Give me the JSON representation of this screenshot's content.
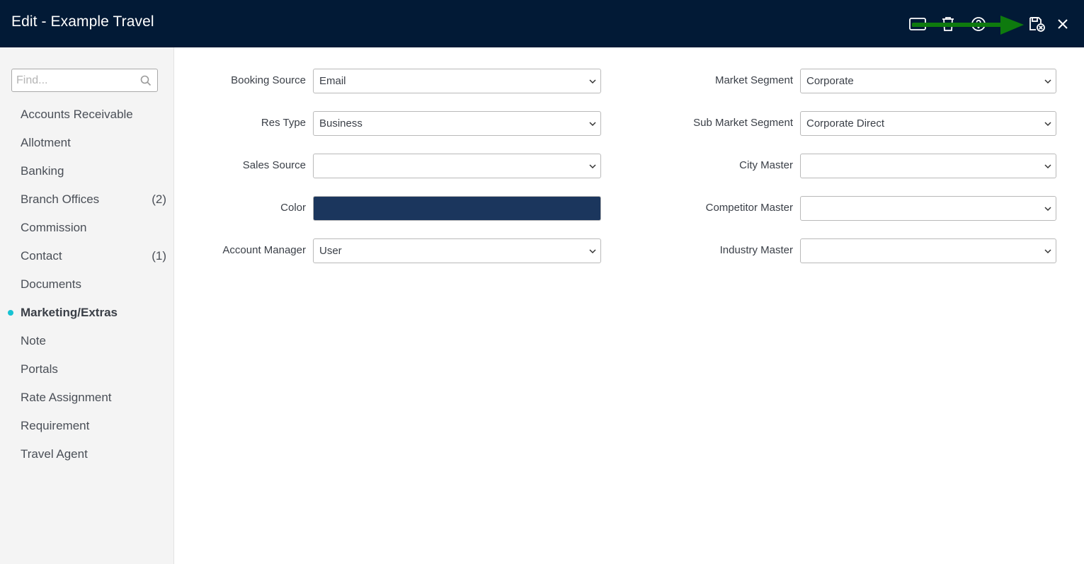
{
  "header": {
    "title": "Edit - Example Travel",
    "icons": [
      "card-icon",
      "trash-icon",
      "help-icon",
      "save-close-icon",
      "close-icon"
    ],
    "background": "#021a36",
    "annotation_arrow_color": "#0e7a0e"
  },
  "sidebar": {
    "search_placeholder": "Find...",
    "items": [
      {
        "label": "Accounts Receivable",
        "count": ""
      },
      {
        "label": "Allotment",
        "count": ""
      },
      {
        "label": "Banking",
        "count": ""
      },
      {
        "label": "Branch Offices",
        "count": "(2)"
      },
      {
        "label": "Commission",
        "count": ""
      },
      {
        "label": "Contact",
        "count": "(1)"
      },
      {
        "label": "Documents",
        "count": ""
      },
      {
        "label": "Marketing/Extras",
        "count": "",
        "active": true
      },
      {
        "label": "Note",
        "count": ""
      },
      {
        "label": "Portals",
        "count": ""
      },
      {
        "label": "Rate Assignment",
        "count": ""
      },
      {
        "label": "Requirement",
        "count": ""
      },
      {
        "label": "Travel Agent",
        "count": ""
      }
    ],
    "active_dot_color": "#17c3d3"
  },
  "form": {
    "left": [
      {
        "label": "Booking Source",
        "value": "Email"
      },
      {
        "label": "Res Type",
        "value": "Business"
      },
      {
        "label": "Sales Source",
        "value": ""
      },
      {
        "label": "Color",
        "value": "",
        "swatch": "#1b365d"
      },
      {
        "label": "Account Manager",
        "value": "User"
      }
    ],
    "right": [
      {
        "label": "Market Segment",
        "value": "Corporate"
      },
      {
        "label": "Sub Market Segment",
        "value": "Corporate Direct"
      },
      {
        "label": "City Master",
        "value": ""
      },
      {
        "label": "Competitor Master",
        "value": ""
      },
      {
        "label": "Industry Master",
        "value": ""
      }
    ]
  }
}
